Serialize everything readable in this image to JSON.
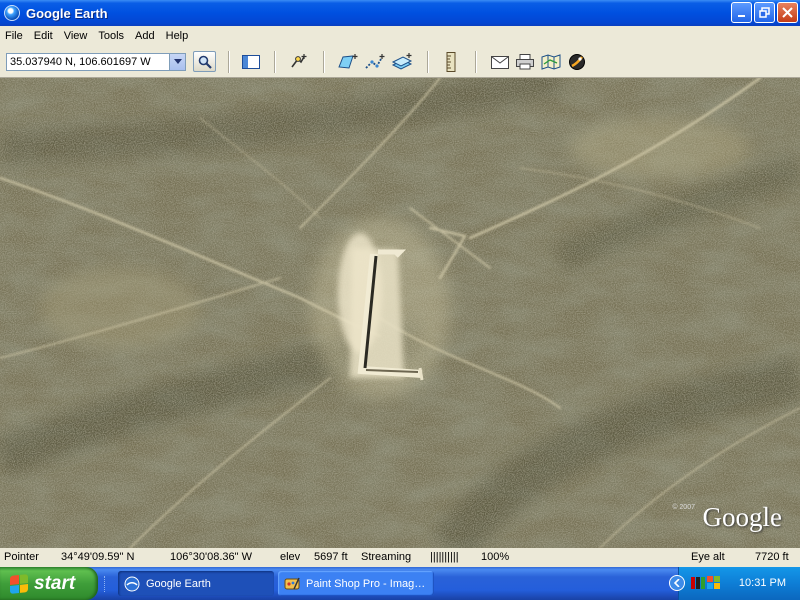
{
  "window": {
    "title": "Google Earth"
  },
  "menu": [
    "File",
    "Edit",
    "View",
    "Tools",
    "Add",
    "Help"
  ],
  "toolbar": {
    "coordinates": "35.037940 N, 106.601697 W"
  },
  "icons": {
    "app": "google-earth-globe-icon",
    "search": "magnifier-icon",
    "sidebar": "sidebar-panel-icon",
    "placemark": "add-placemark-icon",
    "polygon": "add-polygon-icon",
    "path": "add-path-icon",
    "overlay": "image-overlay-icon",
    "ruler": "ruler-icon",
    "email": "email-icon",
    "print": "print-icon",
    "maps": "google-maps-icon",
    "sky": "sky-switch-icon"
  },
  "map": {
    "logo": "Google",
    "copyright": "© 2007"
  },
  "status": {
    "pointer_label": "Pointer",
    "lat": "34°49'09.59\" N",
    "lon": "106°30'08.36\" W",
    "elev_label": "elev",
    "elev_value": "5697 ft",
    "streaming_label": "Streaming",
    "streaming_bar": "||||||||||",
    "streaming_percent": "100%",
    "eye_alt_label": "Eye alt",
    "eye_alt_value": "7720 ft"
  },
  "taskbar": {
    "start_label": "start",
    "tasks": [
      {
        "label": "Google Earth",
        "active": true
      },
      {
        "label": "Paint Shop Pro - Imag…",
        "active": false
      }
    ],
    "clock": "10:31 PM"
  },
  "colors": {
    "titlebar": "#0050e0",
    "start": "#3f9e3a",
    "taskbar": "#245edb",
    "terrain": "#6f6a52"
  }
}
